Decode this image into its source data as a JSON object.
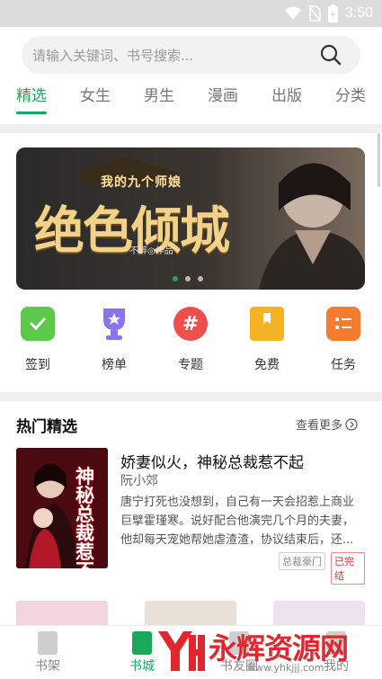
{
  "status_bar": {
    "time": "3:50",
    "icons": [
      "wifi-icon",
      "no-sim-icon",
      "battery-charging-icon"
    ]
  },
  "search": {
    "placeholder": "请输入关键词、书号搜索..."
  },
  "tabs": [
    {
      "label": "精选",
      "active": true
    },
    {
      "label": "女生"
    },
    {
      "label": "男生"
    },
    {
      "label": "漫画"
    },
    {
      "label": "出版"
    },
    {
      "label": "分类"
    }
  ],
  "banner": {
    "top_text": "我的九个师娘",
    "title": "绝色倾城",
    "author": "不醉◎作品",
    "slide_count": 3,
    "active_slide": 0
  },
  "quick_actions": [
    {
      "label": "签到",
      "icon": "calendar-check-icon",
      "color": "#5cc94a"
    },
    {
      "label": "榜单",
      "icon": "trophy-icon",
      "color": "#8a73f0"
    },
    {
      "label": "专题",
      "icon": "hashtag-icon",
      "color": "#f04d4d"
    },
    {
      "label": "免费",
      "icon": "bookmark-icon",
      "color": "#f5b324"
    },
    {
      "label": "任务",
      "icon": "checklist-icon",
      "color": "#f57c2e"
    }
  ],
  "section": {
    "title": "热门精选",
    "more_label": "查看更多"
  },
  "book": {
    "title": "娇妻似火，神秘总裁惹不起",
    "author": "阮小郊",
    "description": "唐宁打死也没想到，自己有一天会招惹上商业巨擘霍瑾寒。说好配合他演完几个月的夫妻，他却每天宠她帮她虐渣渣，协议结束后，还...",
    "tags": [
      "总裁豪门",
      "已完结"
    ],
    "cover_text": "神秘总裁惹不起"
  },
  "bottom_nav": [
    {
      "label": "书架",
      "active": false
    },
    {
      "label": "书城",
      "active": true
    },
    {
      "label": "书友圈",
      "active": false
    },
    {
      "label": "我的",
      "active": false
    }
  ],
  "watermark": {
    "text": "永辉资源网",
    "url": "www.yhkjjj.com"
  },
  "colors": {
    "accent": "#1aa85a",
    "watermark": "#e0262e"
  }
}
